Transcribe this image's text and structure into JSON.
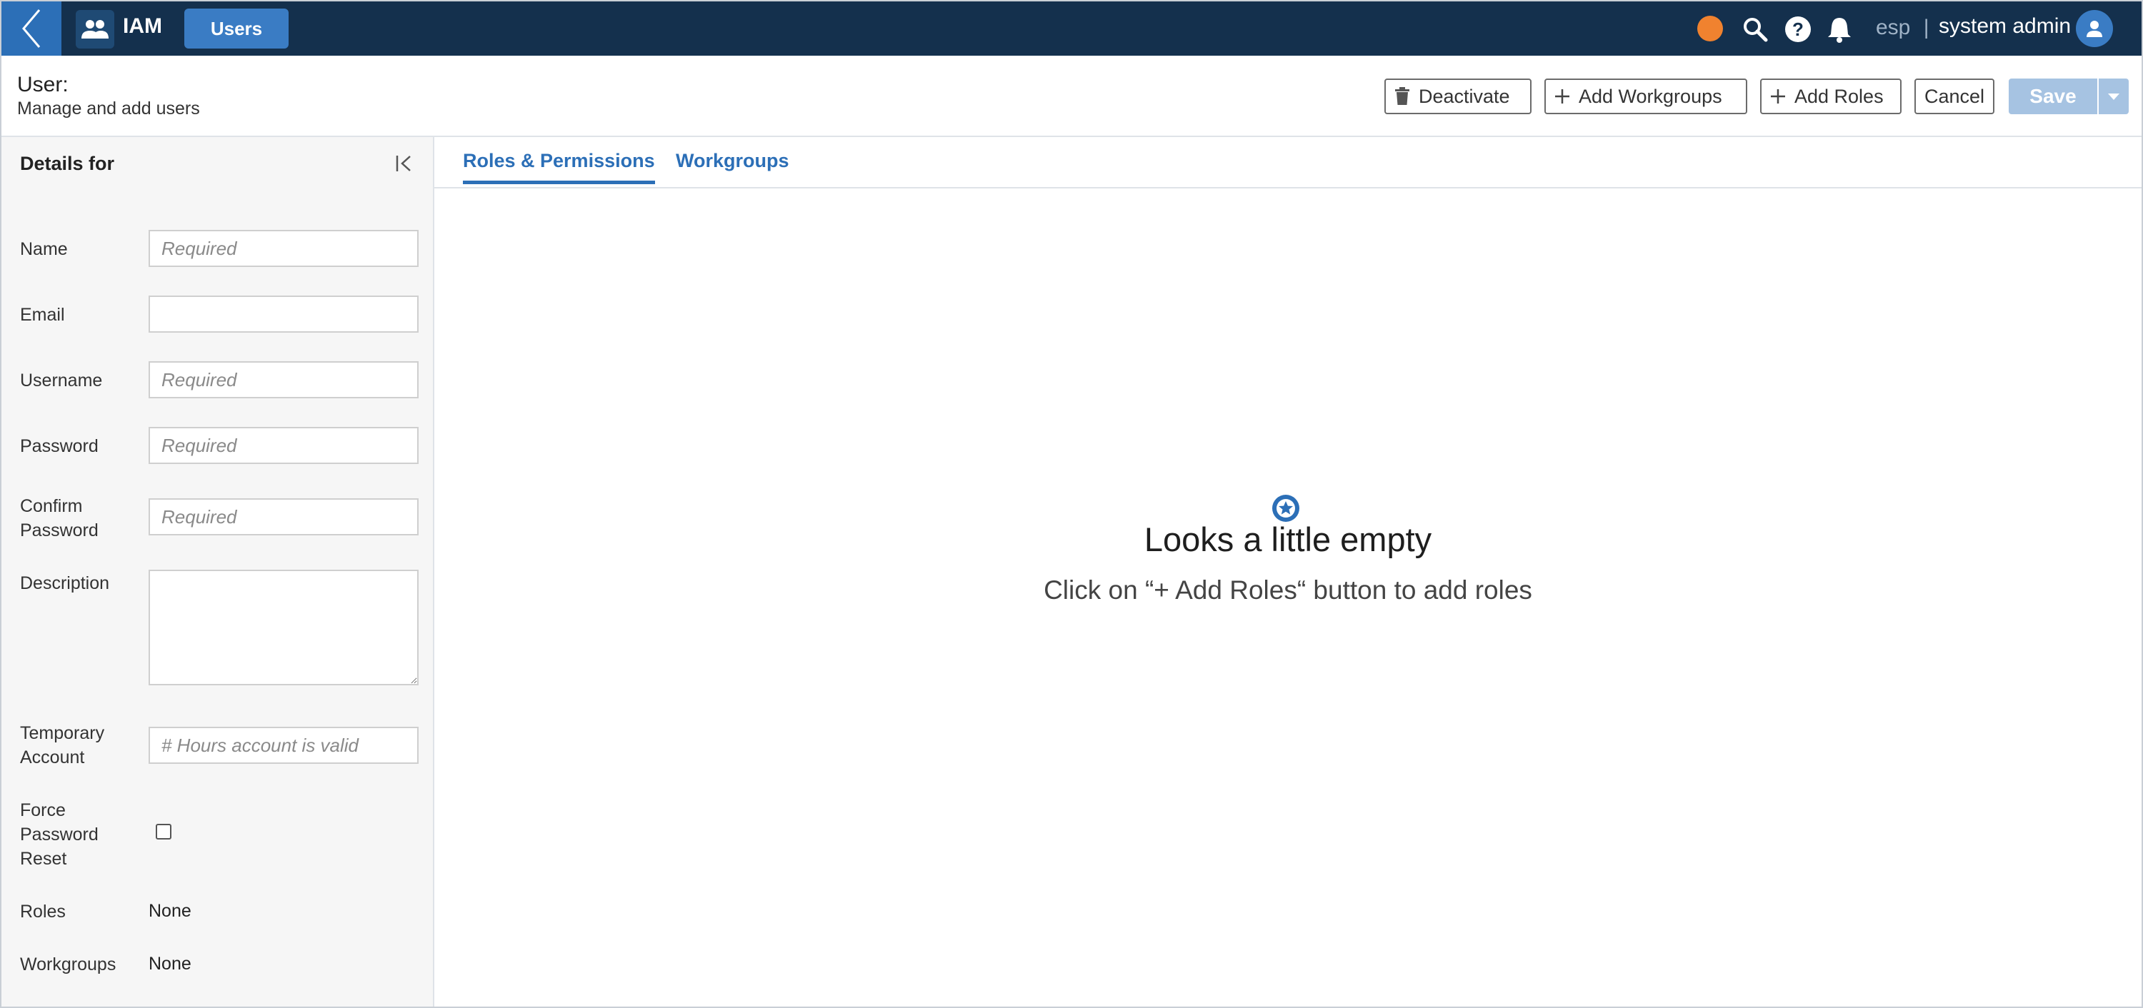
{
  "topbar": {
    "app_name": "IAM",
    "active_tab": "Users",
    "status_color": "#f0822f",
    "icons": [
      "back-chevron-icon",
      "people-icon",
      "search-icon",
      "help-icon",
      "bell-icon",
      "user-avatar-icon"
    ],
    "language": "esp",
    "separator": "|",
    "user_name": "system admin"
  },
  "header": {
    "title": "User:",
    "subtitle": "Manage and add users",
    "buttons": {
      "deactivate": "Deactivate",
      "add_workgroups": "Add Workgroups",
      "add_roles": "Add Roles",
      "cancel": "Cancel",
      "save": "Save"
    }
  },
  "details": {
    "title": "Details for",
    "fields": {
      "name": {
        "label": "Name",
        "value": "",
        "placeholder": "Required"
      },
      "email": {
        "label": "Email",
        "value": "",
        "placeholder": ""
      },
      "username": {
        "label": "Username",
        "value": "",
        "placeholder": "Required"
      },
      "password": {
        "label": "Password",
        "value": "",
        "placeholder": "Required"
      },
      "confirm_password": {
        "label": "Confirm Password",
        "value": "",
        "placeholder": "Required"
      },
      "description": {
        "label": "Description",
        "value": ""
      },
      "temporary_account": {
        "label": "Temporary Account",
        "value": "",
        "placeholder": "# Hours account is valid"
      },
      "force_password_reset": {
        "label": "Force Password Reset",
        "checked": false
      },
      "roles": {
        "label": "Roles",
        "value": "None"
      },
      "workgroups": {
        "label": "Workgroups",
        "value": "None"
      }
    }
  },
  "main": {
    "tabs": [
      {
        "label": "Roles & Permissions",
        "active": true
      },
      {
        "label": "Workgroups",
        "active": false
      }
    ],
    "empty_state": {
      "icon": "star-badge-icon",
      "title": "Looks a little empty",
      "message": "Click on “+ Add Roles“ button to add roles"
    }
  },
  "colors": {
    "topbar_bg": "#14304d",
    "accent": "#2c6fb7",
    "save_disabled": "#a6c3e2"
  }
}
